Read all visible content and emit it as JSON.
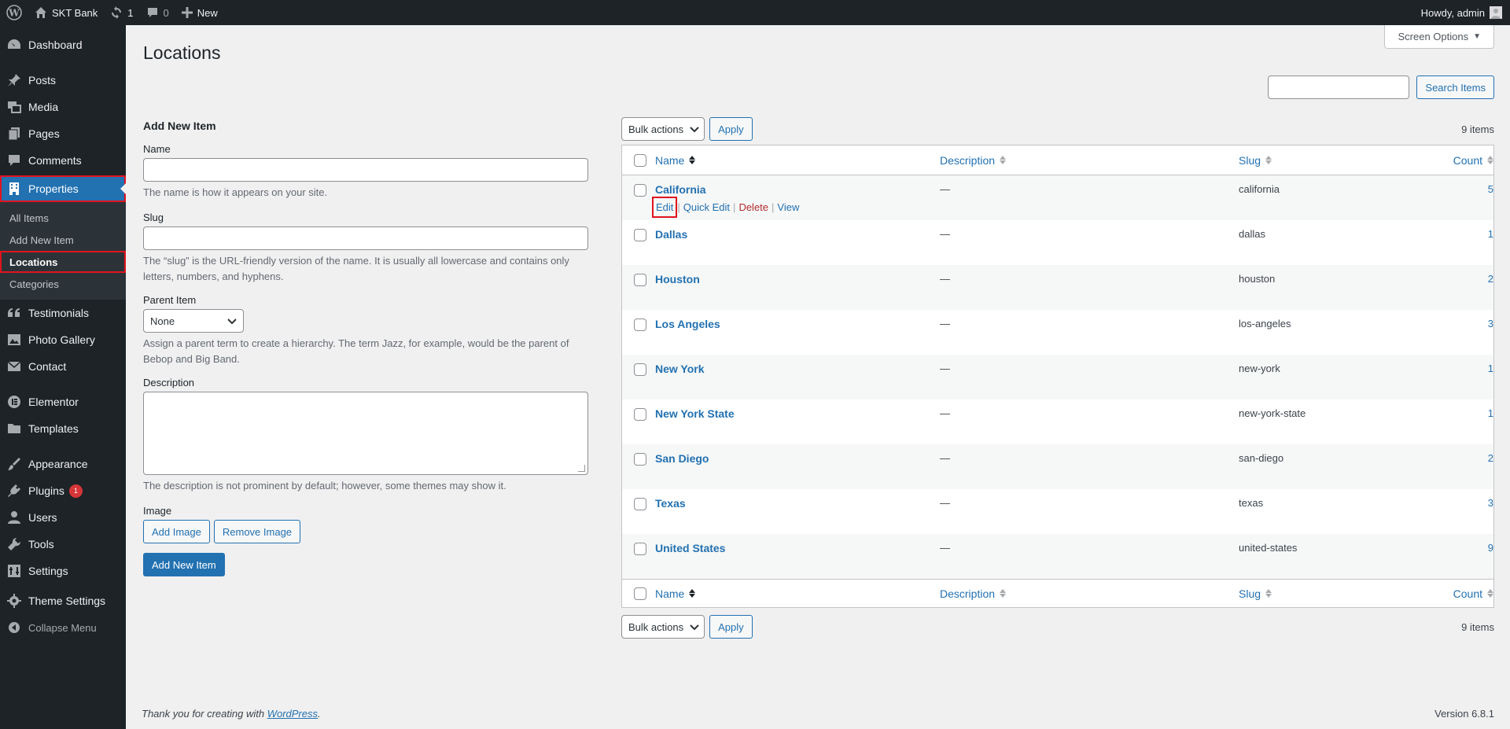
{
  "adminbar": {
    "site_name": "SKT Bank",
    "updates_count": "1",
    "comments_count": "0",
    "new_label": "New",
    "howdy": "Howdy, admin"
  },
  "sidebar": {
    "items": [
      {
        "label": "Dashboard",
        "icon": "dashboard-icon"
      },
      {
        "label": "Posts",
        "icon": "pin-icon"
      },
      {
        "label": "Media",
        "icon": "media-icon"
      },
      {
        "label": "Pages",
        "icon": "pages-icon"
      },
      {
        "label": "Comments",
        "icon": "comment-icon"
      },
      {
        "label": "Properties",
        "icon": "building-icon"
      },
      {
        "label": "Testimonials",
        "icon": "quote-icon"
      },
      {
        "label": "Photo Gallery",
        "icon": "gallery-icon"
      },
      {
        "label": "Contact",
        "icon": "mail-icon"
      },
      {
        "label": "Elementor",
        "icon": "elementor-icon"
      },
      {
        "label": "Templates",
        "icon": "folder-icon"
      },
      {
        "label": "Appearance",
        "icon": "brush-icon"
      },
      {
        "label": "Plugins",
        "icon": "plug-icon",
        "badge": "1"
      },
      {
        "label": "Users",
        "icon": "user-icon"
      },
      {
        "label": "Tools",
        "icon": "wrench-icon"
      },
      {
        "label": "Settings",
        "icon": "sliders-icon"
      },
      {
        "label": "Theme Settings",
        "icon": "gear-icon"
      }
    ],
    "submenu": [
      "All Items",
      "Add New Item",
      "Locations",
      "Categories"
    ],
    "collapse_label": "Collapse Menu"
  },
  "header": {
    "title": "Locations",
    "screen_options": "Screen Options",
    "search_button": "Search Items"
  },
  "form": {
    "heading": "Add New Item",
    "name_label": "Name",
    "name_help": "The name is how it appears on your site.",
    "slug_label": "Slug",
    "slug_help_1": "The “slug” is the URL-friendly version of the name. It is usually all lowercase and contains only",
    "slug_help_2": "letters, numbers, and hyphens.",
    "parent_label": "Parent Item",
    "parent_value": "None",
    "parent_help_1": "Assign a parent term to create a hierarchy. The term Jazz, for example, would be the parent of",
    "parent_help_2": "Bebop and Big Band.",
    "description_label": "Description",
    "description_help": "The description is not prominent by default; however, some themes may show it.",
    "image_label": "Image",
    "add_image": "Add Image",
    "remove_image": "Remove Image",
    "submit": "Add New Item"
  },
  "table": {
    "bulk_actions": "Bulk actions",
    "apply": "Apply",
    "items_count": "9 items",
    "columns": {
      "name": "Name",
      "description": "Description",
      "slug": "Slug",
      "count": "Count"
    },
    "row_actions": {
      "edit": "Edit",
      "quick_edit": "Quick Edit",
      "delete": "Delete",
      "view": "View",
      "sep": "|"
    },
    "rows": [
      {
        "name": "California",
        "description": "—",
        "slug": "california",
        "count": "5"
      },
      {
        "name": "Dallas",
        "description": "—",
        "slug": "dallas",
        "count": "1"
      },
      {
        "name": "Houston",
        "description": "—",
        "slug": "houston",
        "count": "2"
      },
      {
        "name": "Los Angeles",
        "description": "—",
        "slug": "los-angeles",
        "count": "3"
      },
      {
        "name": "New York",
        "description": "—",
        "slug": "new-york",
        "count": "1"
      },
      {
        "name": "New York State",
        "description": "—",
        "slug": "new-york-state",
        "count": "1"
      },
      {
        "name": "San Diego",
        "description": "—",
        "slug": "san-diego",
        "count": "2"
      },
      {
        "name": "Texas",
        "description": "—",
        "slug": "texas",
        "count": "3"
      },
      {
        "name": "United States",
        "description": "—",
        "slug": "united-states",
        "count": "9"
      }
    ]
  },
  "footer": {
    "thanks_prefix": "Thank you for creating with ",
    "thanks_link": "WordPress",
    "thanks_suffix": ".",
    "version": "Version 6.8.1"
  }
}
